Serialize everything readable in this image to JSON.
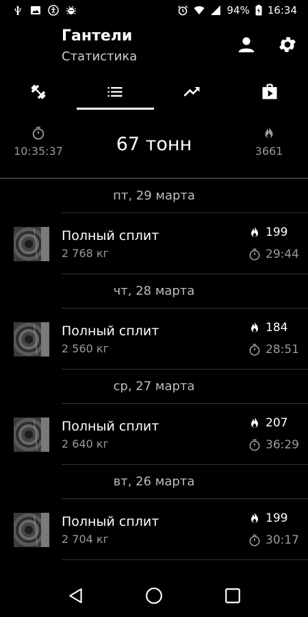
{
  "status_bar": {
    "battery": "94%",
    "time": "16:34"
  },
  "header": {
    "title": "Гантели",
    "subtitle": "Статистика"
  },
  "tabs": [
    {
      "icon": "dumbbell-icon"
    },
    {
      "icon": "list-icon",
      "selected": true
    },
    {
      "icon": "trending-up-icon"
    },
    {
      "icon": "play-bag-icon"
    }
  ],
  "summary": {
    "total_time": "10:35:37",
    "total_weight": "67 тонн",
    "total_calories": "3661"
  },
  "days": [
    {
      "date": "пт, 29 марта",
      "workouts": [
        {
          "name": "Полный сплит",
          "weight": "2 768 кг",
          "calories": "199",
          "duration": "29:44"
        }
      ]
    },
    {
      "date": "чт, 28 марта",
      "workouts": [
        {
          "name": "Полный сплит",
          "weight": "2 560 кг",
          "calories": "184",
          "duration": "28:51"
        }
      ]
    },
    {
      "date": "ср, 27 марта",
      "workouts": [
        {
          "name": "Полный сплит",
          "weight": "2 640 кг",
          "calories": "207",
          "duration": "36:29"
        }
      ]
    },
    {
      "date": "вт, 26 марта",
      "workouts": [
        {
          "name": "Полный сплит",
          "weight": "2 704 кг",
          "calories": "199",
          "duration": "30:17"
        }
      ]
    }
  ],
  "colors": {
    "background": "#000000",
    "text_primary": "#ffffff",
    "text_secondary": "#9a9a9a",
    "divider": "#333333"
  }
}
